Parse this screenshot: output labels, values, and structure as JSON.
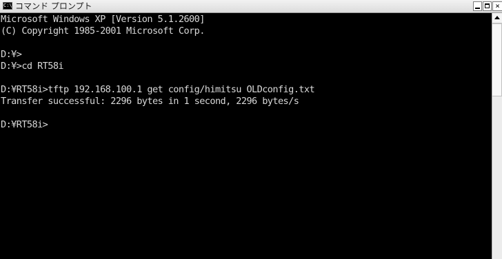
{
  "window": {
    "title": "コマンド プロンプト",
    "icon_label": "C:\\",
    "icon": "console-app-icon"
  },
  "controls": {
    "minimize_icon": "minimize-icon",
    "maximize_icon": "maximize-icon",
    "close_label": "×"
  },
  "console": {
    "lines": [
      "Microsoft Windows XP [Version 5.1.2600]",
      "(C) Copyright 1985-2001 Microsoft Corp.",
      "",
      "D:¥>",
      "D:¥>cd RT58i",
      "",
      "D:¥RT58i>tftp 192.168.100.1 get config/himitsu OLDconfig.txt",
      "Transfer successful: 2296 bytes in 1 second, 2296 bytes/s",
      "",
      "D:¥RT58i>"
    ],
    "text_color": "#d8d8d8",
    "background_color": "#000000"
  },
  "scrollbar": {
    "up_arrow_icon": "scroll-up-arrow-icon",
    "position_fraction": 0.0
  }
}
